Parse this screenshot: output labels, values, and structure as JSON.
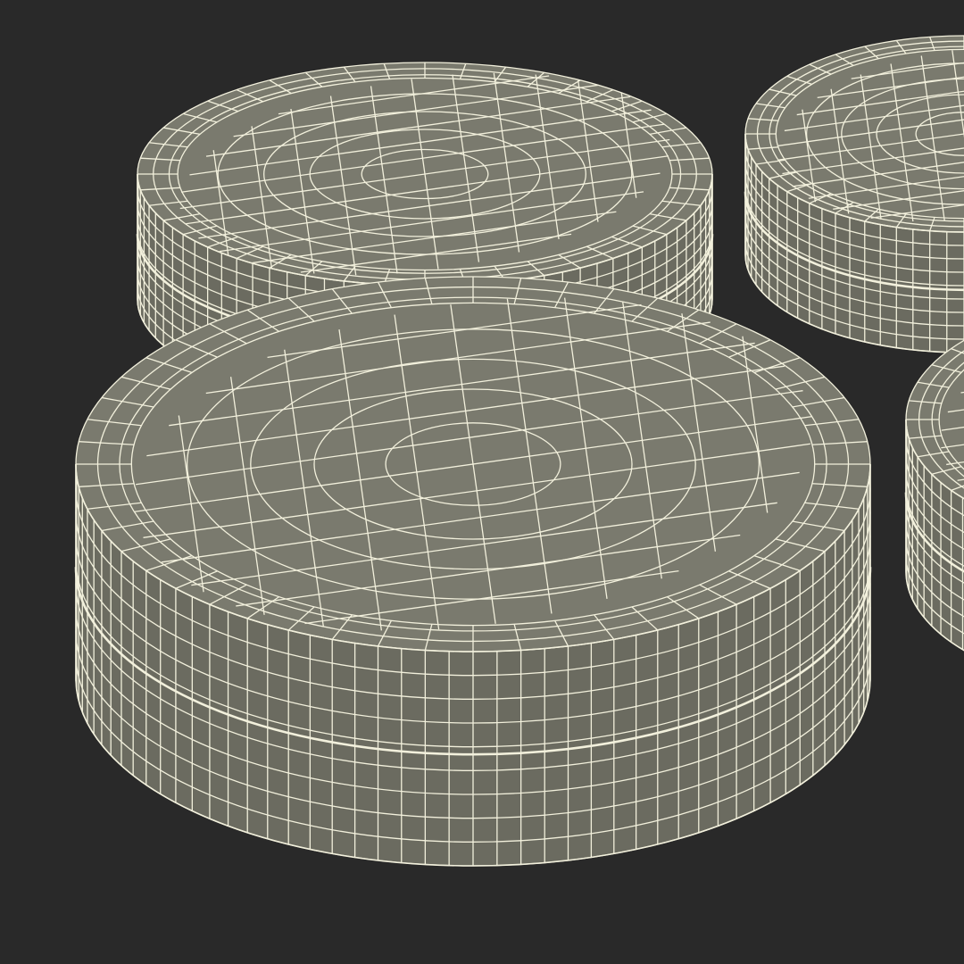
{
  "scene": {
    "background_color": "#292929",
    "shade_color": "#7a7a6e",
    "shade_dark_color": "#6b6b60",
    "wire_color": "#f2f0dc",
    "objects": [
      {
        "name": "puck-back-left"
      },
      {
        "name": "puck-back-right"
      },
      {
        "name": "puck-right-partial"
      },
      {
        "name": "puck-front"
      }
    ]
  }
}
